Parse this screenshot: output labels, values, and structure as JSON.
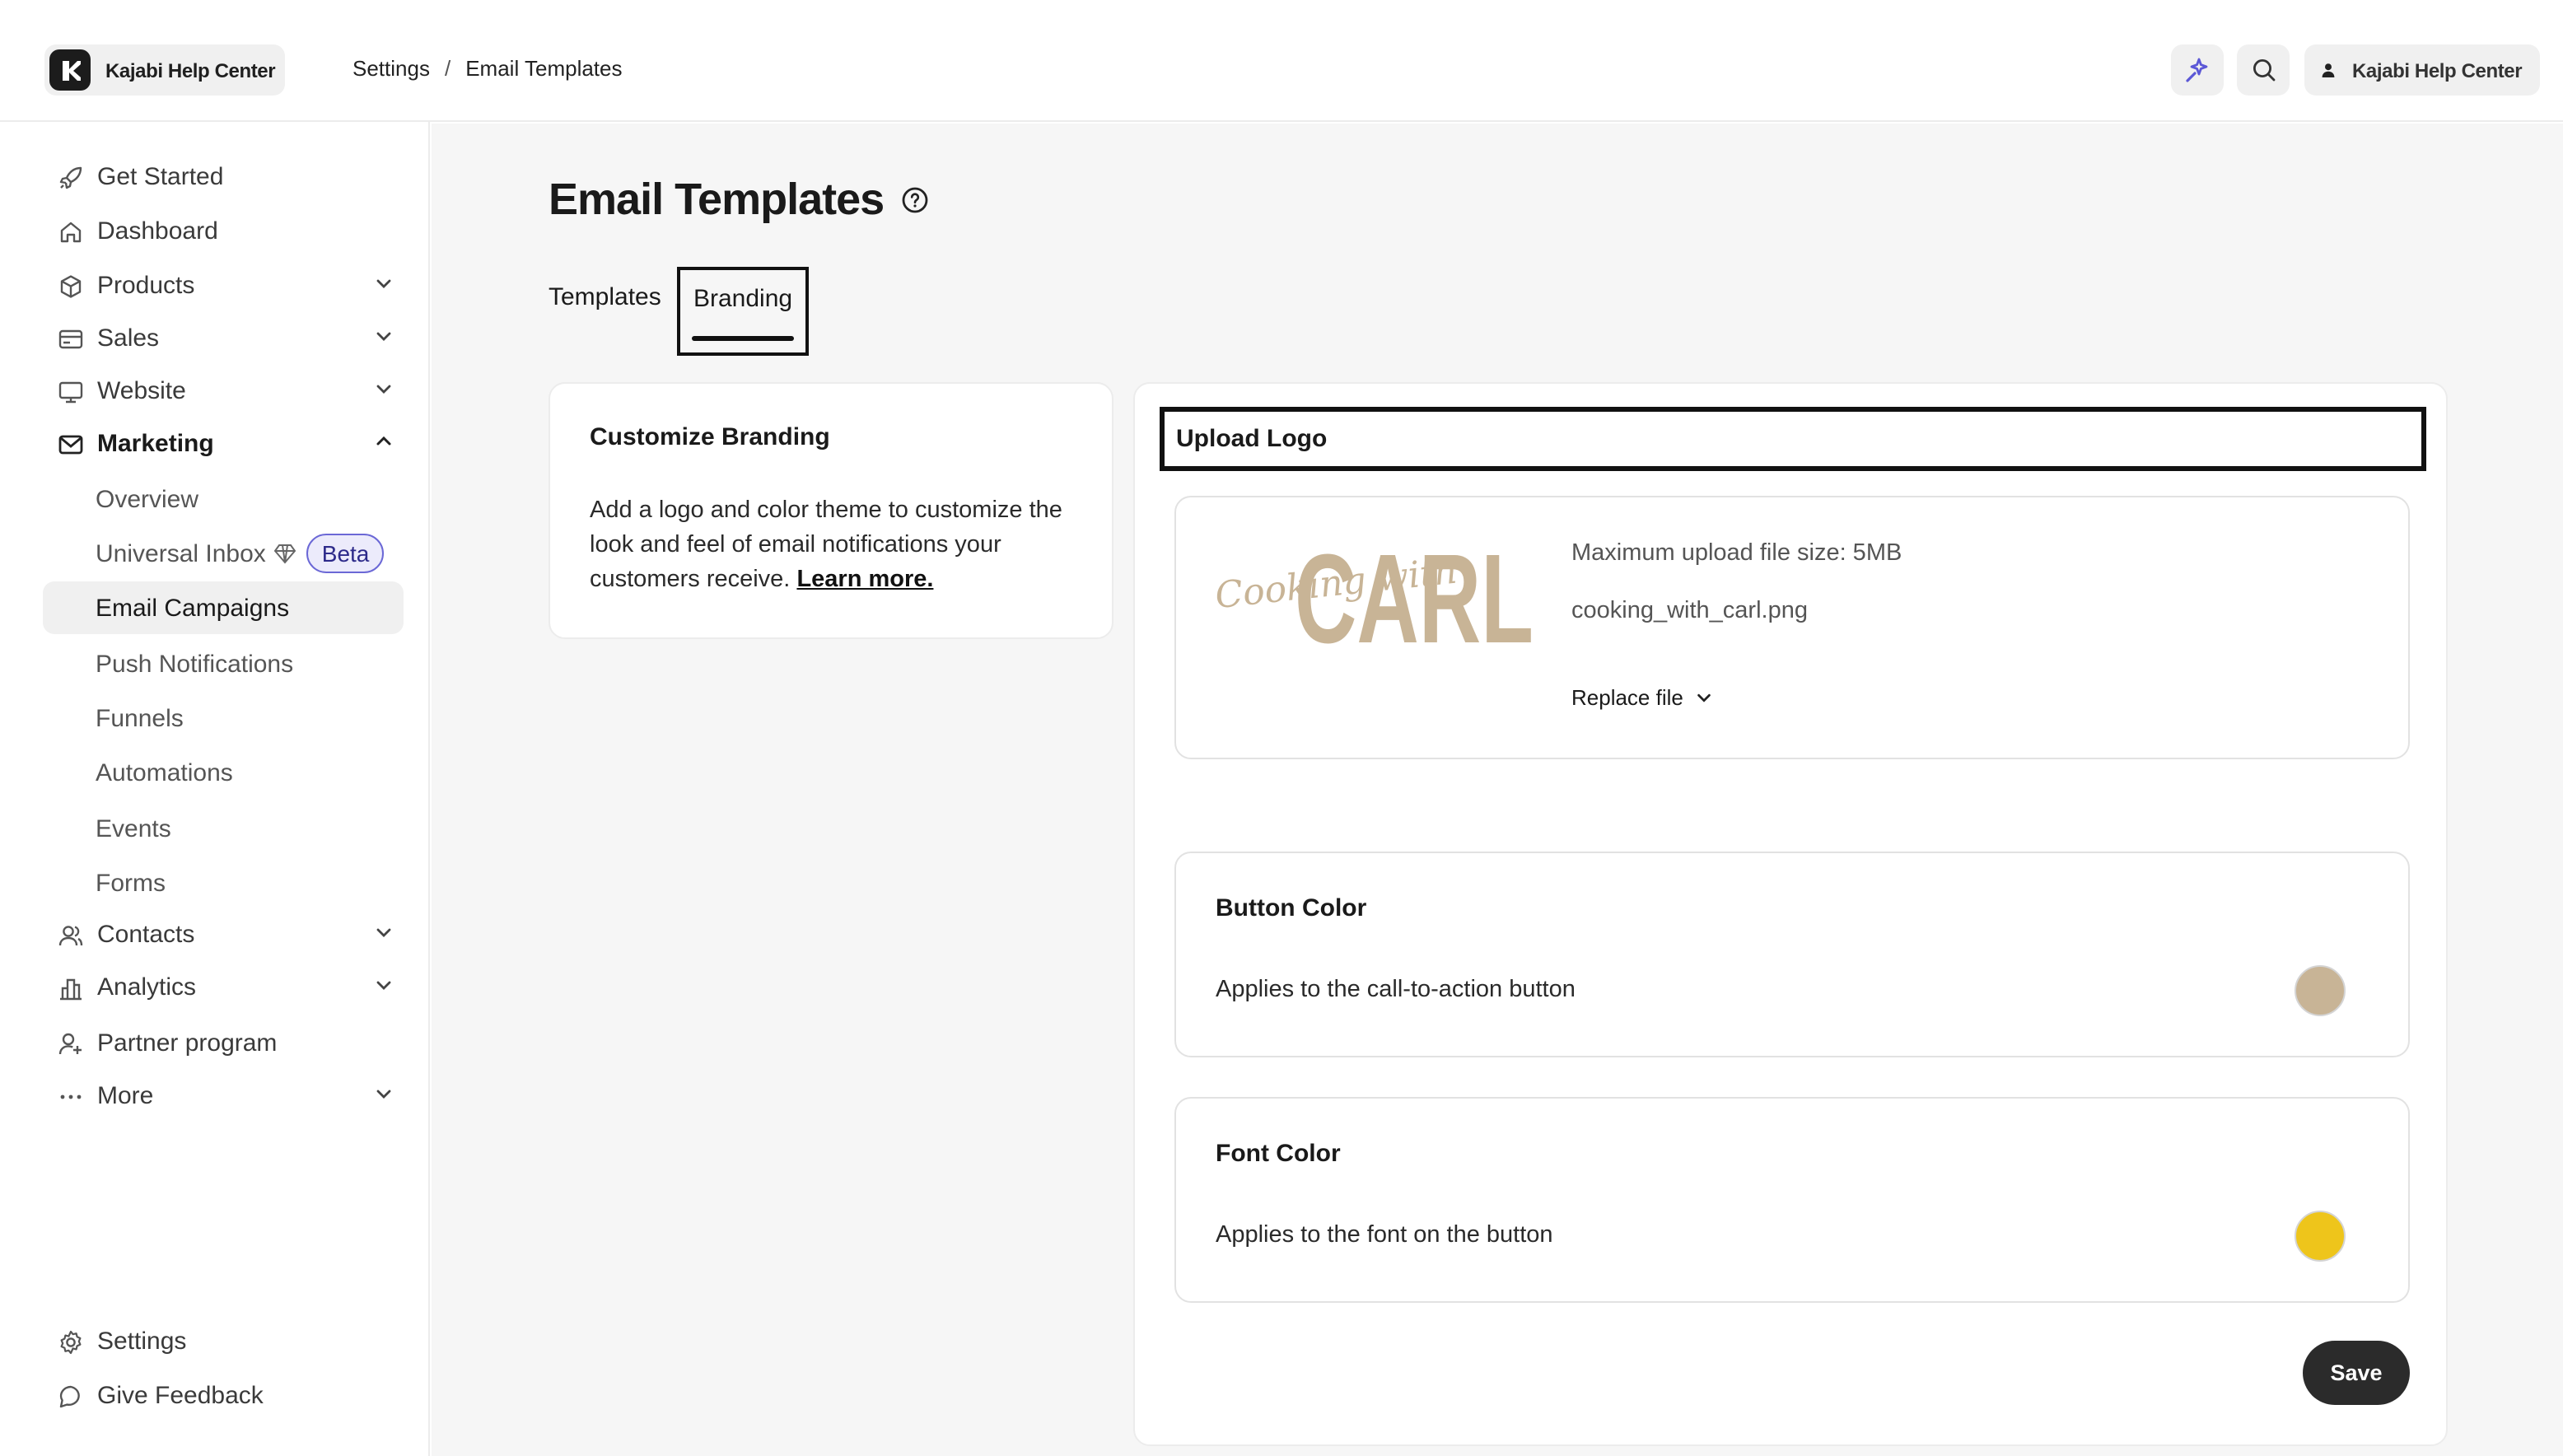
{
  "topbar": {
    "brand": "Kajabi Help Center",
    "breadcrumb": [
      "Settings",
      "Email Templates"
    ],
    "breadcrumb_sep": "/",
    "user_label": "Kajabi Help Center"
  },
  "sidebar": {
    "items": [
      {
        "label": "Get Started",
        "icon": "rocket-icon"
      },
      {
        "label": "Dashboard",
        "icon": "home-icon"
      },
      {
        "label": "Products",
        "icon": "box-icon"
      },
      {
        "label": "Sales",
        "icon": "card-icon"
      },
      {
        "label": "Website",
        "icon": "monitor-icon"
      },
      {
        "label": "Marketing",
        "icon": "mail-icon"
      }
    ],
    "marketing_sub": [
      "Overview",
      "Universal Inbox",
      "Email Campaigns",
      "Push Notifications",
      "Funnels",
      "Automations",
      "Events",
      "Forms"
    ],
    "beta_label": "Beta",
    "items2": [
      {
        "label": "Contacts",
        "icon": "users-icon"
      },
      {
        "label": "Analytics",
        "icon": "chart-icon"
      },
      {
        "label": "Partner program",
        "icon": "partner-icon"
      },
      {
        "label": "More",
        "icon": "more-icon"
      }
    ],
    "footer": [
      {
        "label": "Settings",
        "icon": "gear-icon"
      },
      {
        "label": "Give Feedback",
        "icon": "chat-icon"
      }
    ]
  },
  "main": {
    "title": "Email Templates",
    "tabs": [
      "Templates",
      "Branding"
    ],
    "active_tab": "Branding",
    "customize": {
      "title": "Customize Branding",
      "body": "Add a logo and color theme to customize the look and feel of email notifications your customers receive.",
      "link": "Learn more."
    },
    "upload": {
      "title": "Upload Logo",
      "logo_script": "Cooking with",
      "logo_word": "CARL",
      "max_size": "Maximum upload file size: 5MB",
      "filename": "cooking_with_carl.png",
      "replace_label": "Replace file"
    },
    "button_color": {
      "title": "Button Color",
      "desc": "Applies to the call-to-action button",
      "color": "#c8b496"
    },
    "font_color": {
      "title": "Font Color",
      "desc": "Applies to the font on the button",
      "color": "#eec51b"
    },
    "save_label": "Save"
  },
  "colors": {
    "accent": "#5b57d6",
    "logo_tan": "#c8b496"
  }
}
